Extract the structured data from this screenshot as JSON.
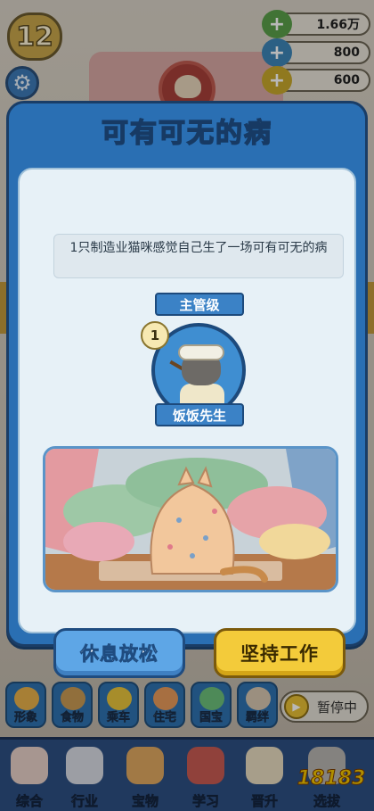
{
  "hud": {
    "level": "12",
    "resources": [
      {
        "icon": "cash-plus-icon",
        "value": "1.66万"
      },
      {
        "icon": "globe-plus-icon",
        "value": "800"
      },
      {
        "icon": "coin-plus-icon",
        "value": "600"
      }
    ]
  },
  "modal": {
    "title": "可有可无的病",
    "description": "1只制造业猫咪感觉自己生了一场可有可无的病",
    "rank": "主管级",
    "cat_level": "1",
    "cat_name": "饭饭先生",
    "buttons": {
      "rest": "休息放松",
      "work": "坚持工作"
    }
  },
  "quick_bar": {
    "items": [
      "形象",
      "食物",
      "乘车",
      "住宅",
      "国宝",
      "羁绊"
    ],
    "pause_label": "暂停中"
  },
  "bottom_nav": {
    "items": [
      "综合",
      "行业",
      "宝物",
      "学习",
      "晋升",
      "选拔"
    ]
  },
  "watermark": "18183",
  "colors": {
    "modal_blue": "#2a6fb3",
    "rest_button": "#5ea6e6",
    "work_button": "#f3cb3a"
  }
}
